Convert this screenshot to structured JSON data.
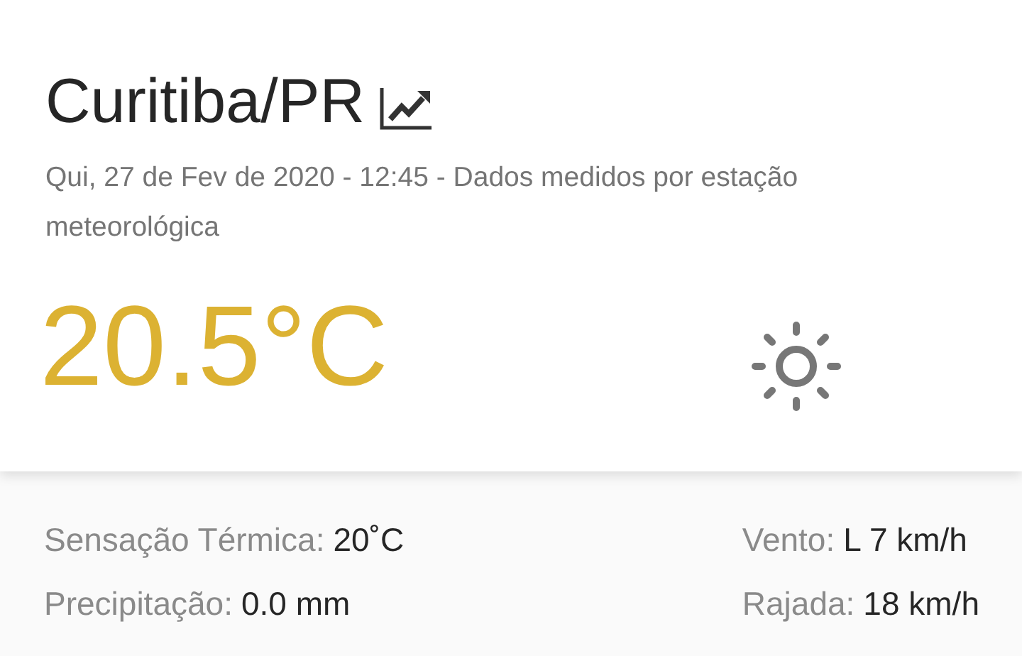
{
  "location": {
    "city": "Curitiba/PR",
    "subtitle": "Qui, 27 de Fev de 2020 - 12:45 - Dados medidos por estação meteorológica"
  },
  "current": {
    "temperature": "20.5°C"
  },
  "details": [
    [
      {
        "label": "Sensação Térmica:",
        "value": "20˚C"
      },
      {
        "label": "Precipitação:",
        "value": "0.0 mm"
      }
    ],
    [
      {
        "label": "Vento:",
        "value": "L 7 km/h"
      },
      {
        "label": "Rajada:",
        "value": "18 km/h"
      }
    ]
  ]
}
